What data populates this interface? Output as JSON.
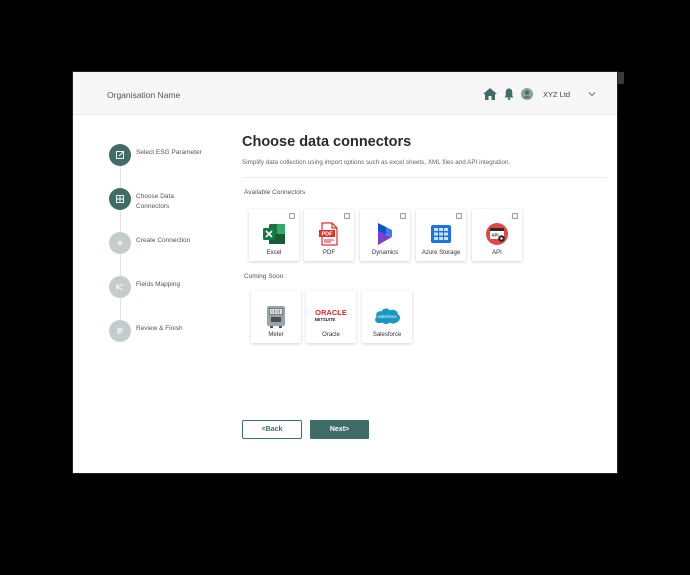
{
  "header": {
    "org_name": "Organisation Name",
    "company": "XYZ Ltd",
    "icons": [
      "home-icon",
      "bell-icon",
      "user-icon",
      "chevron-down-icon"
    ]
  },
  "steps": [
    {
      "label": "Select ESG Parameter",
      "state": "active",
      "icon": "edit-icon"
    },
    {
      "label": "Choose Data Connectors",
      "state": "active",
      "icon": "grid-icon"
    },
    {
      "label": "Create Connection",
      "state": "inactive",
      "icon": "plus-icon"
    },
    {
      "label": "Fields Mapping",
      "state": "inactive",
      "icon": "mapping-icon"
    },
    {
      "label": "Review & Finish",
      "state": "inactive",
      "icon": "review-icon"
    }
  ],
  "main": {
    "title": "Choose data connectors",
    "subtitle": "Simplify data collection using import options such as excel sheets, XML files and API integration.",
    "available_label": "Available Connectors",
    "coming_soon_label": "Coming Soon",
    "available": [
      {
        "label": "Excel",
        "icon": "excel-icon"
      },
      {
        "label": "PDF",
        "icon": "pdf-icon"
      },
      {
        "label": "Dynamics",
        "icon": "dynamics-icon"
      },
      {
        "label": "Azure Storage",
        "icon": "azure-storage-icon"
      },
      {
        "label": "API",
        "icon": "api-icon"
      }
    ],
    "coming_soon": [
      {
        "label": "Meter",
        "icon": "meter-icon"
      },
      {
        "label": "Oracle",
        "icon": "oracle-netsuite-logo"
      },
      {
        "label": "Salesforce",
        "icon": "salesforce-logo"
      }
    ],
    "oracle_logo_text": "ORACLE",
    "netsuite_logo_text": "NETSUITE",
    "salesforce_logo_text": "salesforce",
    "pdf_logo_text": "PDF",
    "api_logo_text": "API"
  },
  "buttons": {
    "back": "<Back",
    "next": "Next>"
  },
  "colors": {
    "accent": "#3f6c67",
    "inactive_step": "#c4cdcb",
    "topbar": "#f6f7f6"
  }
}
